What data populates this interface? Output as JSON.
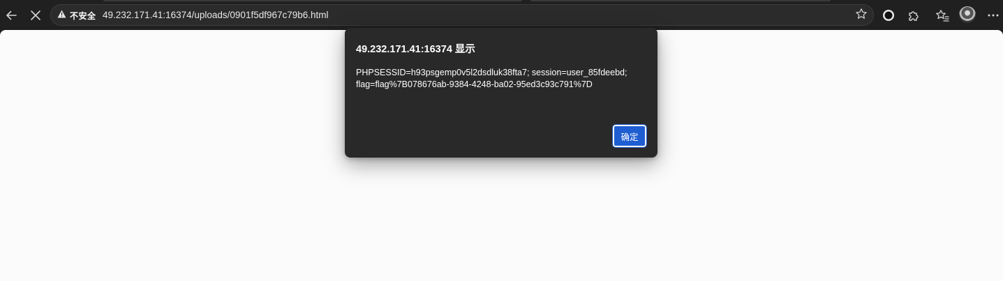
{
  "browser": {
    "security_label": "不安全",
    "url": "49.232.171.41:16374/uploads/0901f5df967c79b6.html",
    "icons": {
      "back": "back-arrow-icon",
      "stop": "stop-loading-icon",
      "warning": "warning-triangle-icon",
      "favorite": "star-icon",
      "extension_record": "record-extension-icon",
      "extensions": "puzzle-icon",
      "favorites": "favorites-icon",
      "profile": "avatar",
      "more": "more-icon"
    }
  },
  "dialog": {
    "title": "49.232.171.41:16374 显示",
    "message_line1": "PHPSESSID=h93psgemp0v5l2dsdluk38fta7; session=user_85fdeebd;",
    "message_line2": "flag=flag%7B078676ab-9384-4248-ba02-95ed3c93c791%7D",
    "ok_label": "确定"
  },
  "colors": {
    "chrome_bg": "#202020",
    "omnibox_bg": "#2b2b2b",
    "page_bg": "#fbfbfb",
    "dialog_bg": "#292929",
    "button_accent": "#1f5ed1"
  }
}
